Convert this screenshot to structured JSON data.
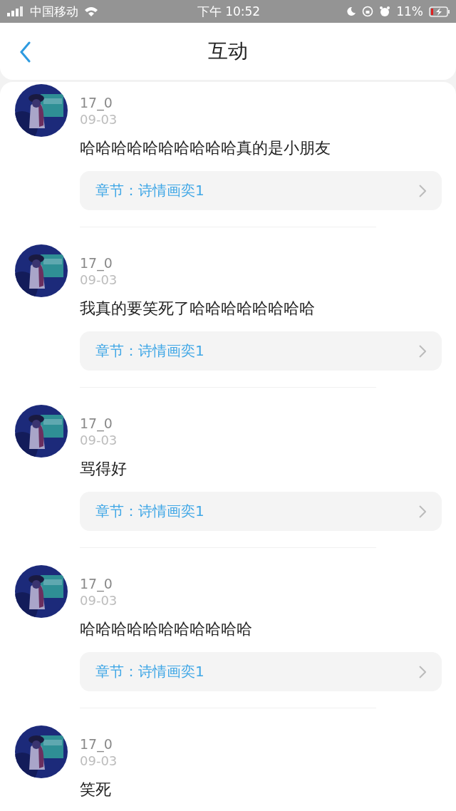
{
  "status_bar": {
    "carrier": "中国移动",
    "time": "下午 10:52",
    "battery": "11%"
  },
  "header": {
    "title": "互动"
  },
  "comments": [
    {
      "user": "17_0",
      "date": "09-03",
      "text": "哈哈哈哈哈哈哈哈哈哈真的是小朋友",
      "chapter": {
        "label": "章节：",
        "name": "诗情画奕1"
      }
    },
    {
      "user": "17_0",
      "date": "09-03",
      "text": "我真的要笑死了哈哈哈哈哈哈哈哈",
      "chapter": {
        "label": "章节：",
        "name": "诗情画奕1"
      }
    },
    {
      "user": "17_0",
      "date": "09-03",
      "text": "骂得好",
      "chapter": {
        "label": "章节：",
        "name": "诗情画奕1"
      }
    },
    {
      "user": "17_0",
      "date": "09-03",
      "text": "哈哈哈哈哈哈哈哈哈哈哈",
      "chapter": {
        "label": "章节：",
        "name": "诗情画奕1"
      }
    },
    {
      "user": "17_0",
      "date": "09-03",
      "text": "笑死"
    }
  ]
}
